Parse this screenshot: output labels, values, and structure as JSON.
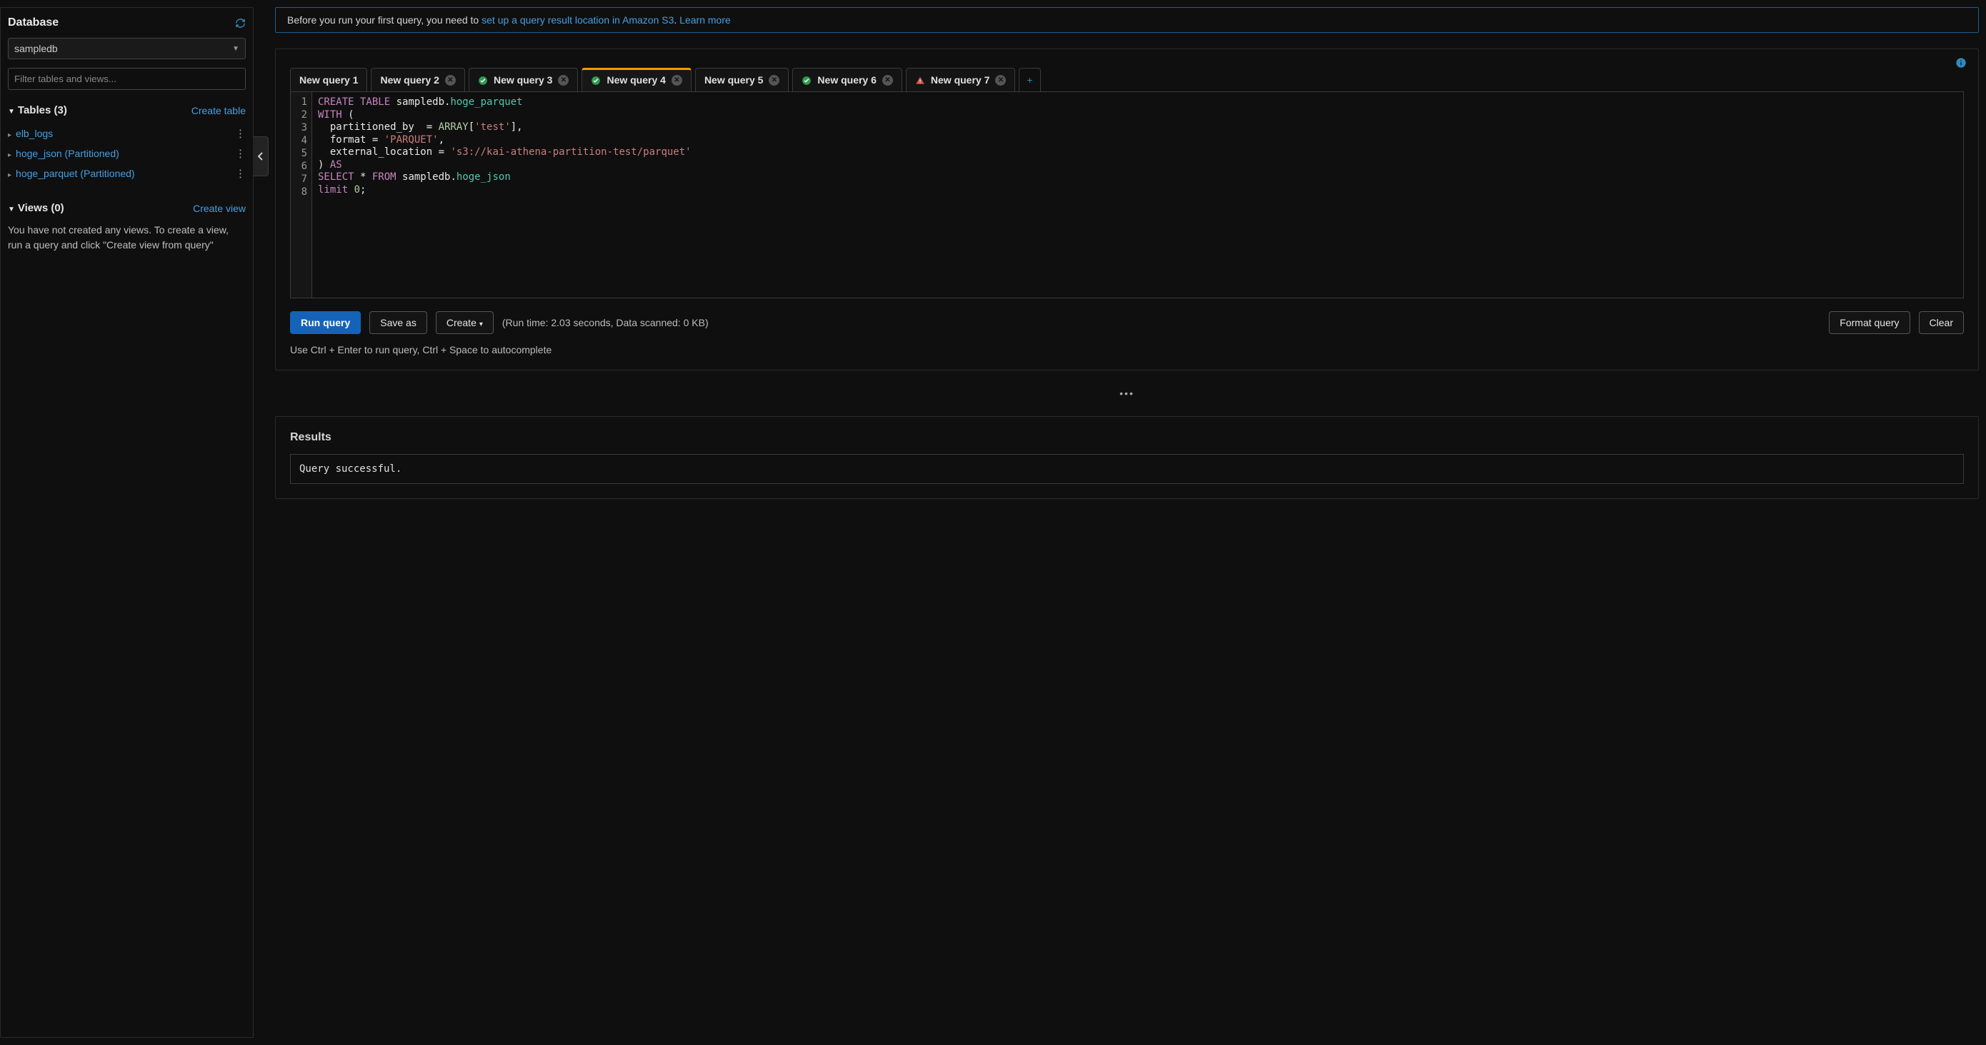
{
  "sidebar": {
    "title": "Database",
    "selected_db": "sampledb",
    "filter_placeholder": "Filter tables and views...",
    "tables_header": "Tables (3)",
    "create_table_label": "Create table",
    "tables": [
      {
        "name": "elb_logs"
      },
      {
        "name": "hoge_json (Partitioned)"
      },
      {
        "name": "hoge_parquet (Partitioned)"
      }
    ],
    "views_header": "Views (0)",
    "create_view_label": "Create view",
    "views_help": "You have not created any views. To create a view, run a query and click \"Create view from query\""
  },
  "banner": {
    "prefix": "Before you run your first query, you need to ",
    "link1": "set up a query result location in Amazon S3",
    "middle": ". ",
    "link2": "Learn more"
  },
  "tabs": [
    {
      "label": "New query 1",
      "status": "none",
      "closeable": false,
      "active": false
    },
    {
      "label": "New query 2",
      "status": "none",
      "closeable": true,
      "active": false
    },
    {
      "label": "New query 3",
      "status": "ok",
      "closeable": true,
      "active": false
    },
    {
      "label": "New query 4",
      "status": "ok",
      "closeable": true,
      "active": true
    },
    {
      "label": "New query 5",
      "status": "none",
      "closeable": true,
      "active": false
    },
    {
      "label": "New query 6",
      "status": "ok",
      "closeable": true,
      "active": false
    },
    {
      "label": "New query 7",
      "status": "warn",
      "closeable": true,
      "active": false
    }
  ],
  "editor": {
    "line_count": 8,
    "tokens": [
      [
        {
          "t": "CREATE TABLE",
          "c": "kw"
        },
        {
          "t": " sampledb.",
          "c": ""
        },
        {
          "t": "hoge_parquet",
          "c": "id"
        }
      ],
      [
        {
          "t": "WITH",
          "c": "kw"
        },
        {
          "t": " (",
          "c": ""
        }
      ],
      [
        {
          "t": "  partitioned_by  = ",
          "c": ""
        },
        {
          "t": "ARRAY",
          "c": "fn"
        },
        {
          "t": "[",
          "c": ""
        },
        {
          "t": "'test'",
          "c": "str"
        },
        {
          "t": "],",
          "c": ""
        }
      ],
      [
        {
          "t": "  format = ",
          "c": ""
        },
        {
          "t": "'PARQUET'",
          "c": "str"
        },
        {
          "t": ",",
          "c": ""
        }
      ],
      [
        {
          "t": "  external_location = ",
          "c": ""
        },
        {
          "t": "'s3://kai-athena-partition-test/parquet'",
          "c": "str"
        }
      ],
      [
        {
          "t": ") ",
          "c": ""
        },
        {
          "t": "AS",
          "c": "kw"
        }
      ],
      [
        {
          "t": "SELECT",
          "c": "sel"
        },
        {
          "t": " * ",
          "c": ""
        },
        {
          "t": "FROM",
          "c": "sel"
        },
        {
          "t": " sampledb.",
          "c": ""
        },
        {
          "t": "hoge_json",
          "c": "id"
        }
      ],
      [
        {
          "t": "limit",
          "c": "sel"
        },
        {
          "t": " ",
          "c": ""
        },
        {
          "t": "0",
          "c": "fn"
        },
        {
          "t": ";",
          "c": ""
        }
      ]
    ]
  },
  "actions": {
    "run": "Run query",
    "save_as": "Save as",
    "create": "Create",
    "stats": "(Run time: 2.03 seconds, Data scanned: 0 KB)",
    "format": "Format query",
    "clear": "Clear",
    "hint": "Use Ctrl + Enter to run query, Ctrl + Space to autocomplete"
  },
  "results": {
    "title": "Results",
    "message": "Query successful."
  }
}
